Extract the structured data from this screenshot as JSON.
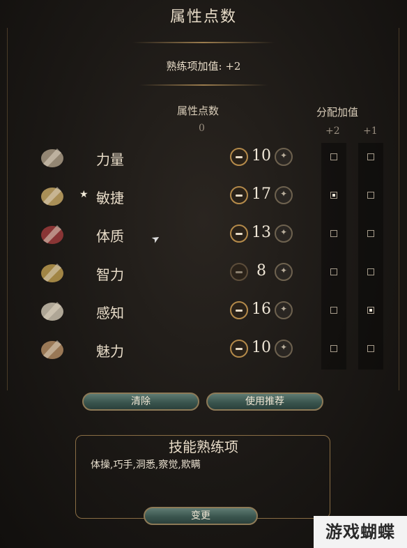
{
  "panel": {
    "title": "属性点数",
    "proficiency_bonus": "熟练项加值: +2"
  },
  "columns": {
    "points_header": "属性点数",
    "points_remaining": "0",
    "allocate_header": "分配加值",
    "plus2_label": "+2",
    "plus1_label": "+1"
  },
  "abilities": [
    {
      "name": "力量",
      "icon": "strength-arm-icon",
      "value": "10",
      "starred": false,
      "plus2": false,
      "plus1": false,
      "minus_enabled": true
    },
    {
      "name": "敏捷",
      "icon": "dexterity-boot-icon",
      "value": "17",
      "starred": true,
      "plus2": true,
      "plus1": false,
      "minus_enabled": true
    },
    {
      "name": "体质",
      "icon": "constitution-heart-icon",
      "value": "13",
      "starred": false,
      "plus2": false,
      "plus1": false,
      "minus_enabled": true
    },
    {
      "name": "智力",
      "icon": "intelligence-book-icon",
      "value": "8",
      "starred": false,
      "plus2": false,
      "plus1": false,
      "minus_enabled": false
    },
    {
      "name": "感知",
      "icon": "wisdom-scroll-icon",
      "value": "16",
      "starred": false,
      "plus2": false,
      "plus1": true,
      "minus_enabled": true
    },
    {
      "name": "魅力",
      "icon": "charisma-hand-icon",
      "value": "10",
      "starred": false,
      "plus2": false,
      "plus1": false,
      "minus_enabled": true
    }
  ],
  "star_glyph": "★",
  "buttons": {
    "clear": "清除",
    "use_recommended": "使用推荐",
    "change": "变更"
  },
  "skills": {
    "title": "技能熟练项",
    "list": "体操,巧手,洞悉,察觉,欺瞒"
  },
  "watermark": "游戏蝴蝶",
  "colors": {
    "accent_gold": "#b48a4a",
    "button_teal": "#3a554e",
    "text": "#e8dcc8"
  }
}
